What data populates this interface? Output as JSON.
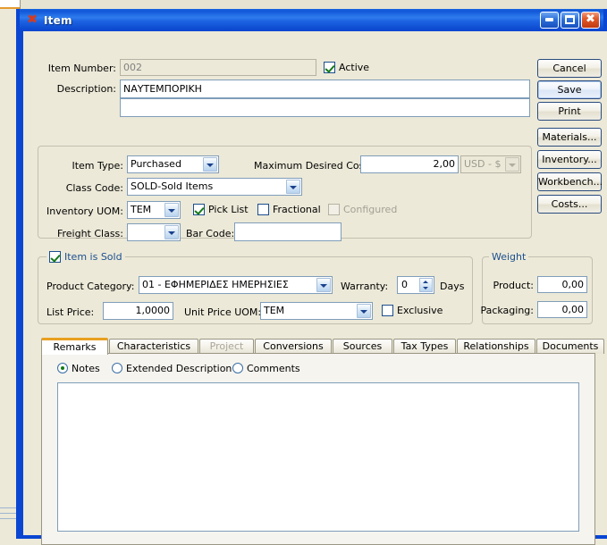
{
  "window": {
    "title": "Item",
    "icon": "app-x-icon",
    "buttons": {
      "minimize": "minimize",
      "maximize": "maximize",
      "close": "close"
    }
  },
  "form": {
    "item_number": {
      "label": "Item Number:",
      "value": "002",
      "disabled": true
    },
    "active": {
      "label": "Active",
      "checked": true
    },
    "description": {
      "label": "Description:",
      "line1": "ΝΑΥΤΕΜΠΟΡΙΚΗ",
      "line2": ""
    },
    "item_type": {
      "label": "Item Type:",
      "value": "Purchased"
    },
    "maximum_desired_cost": {
      "label": "Maximum Desired Cost:",
      "value": "2,00"
    },
    "currency": {
      "value": "USD - $",
      "disabled": true
    },
    "class_code": {
      "label": "Class Code:",
      "value": "SOLD-Sold Items"
    },
    "inventory_uom": {
      "label": "Inventory UOM:",
      "value": "TEM"
    },
    "pick_list": {
      "label": "Pick List",
      "checked": true
    },
    "fractional": {
      "label": "Fractional",
      "checked": false
    },
    "configured": {
      "label": "Configured",
      "checked": false,
      "disabled": true
    },
    "freight_class": {
      "label": "Freight Class:",
      "value": ""
    },
    "bar_code": {
      "label": "Bar Code:",
      "value": ""
    }
  },
  "item_is_sold": {
    "title": "Item is Sold",
    "checked": true,
    "product_category": {
      "label": "Product Category:",
      "value": "01 - ΕΦΗΜΕΡΙΔΕΣ ΗΜΕΡΗΣΙΕΣ"
    },
    "warranty": {
      "label": "Warranty:",
      "value": "0",
      "units": "Days"
    },
    "list_price": {
      "label": "List Price:",
      "value": "1,0000"
    },
    "unit_price_uom": {
      "label": "Unit Price UOM:",
      "value": "TEM"
    },
    "exclusive": {
      "label": "Exclusive",
      "checked": false
    }
  },
  "weight": {
    "title": "Weight",
    "product": {
      "label": "Product:",
      "value": "0,00"
    },
    "packaging": {
      "label": "Packaging:",
      "value": "0,00"
    }
  },
  "actions": {
    "cancel": "Cancel",
    "save": "Save",
    "print": "Print",
    "materials": "Materials...",
    "inventory": "Inventory...",
    "workbench": "Workbench...",
    "costs": "Costs..."
  },
  "tabs": [
    {
      "label": "Remarks",
      "active": true,
      "disabled": false
    },
    {
      "label": "Characteristics",
      "active": false,
      "disabled": false
    },
    {
      "label": "Project",
      "active": false,
      "disabled": true
    },
    {
      "label": "Conversions",
      "active": false,
      "disabled": false
    },
    {
      "label": "Sources",
      "active": false,
      "disabled": false
    },
    {
      "label": "Tax Types",
      "active": false,
      "disabled": false
    },
    {
      "label": "Relationships",
      "active": false,
      "disabled": false
    },
    {
      "label": "Documents",
      "active": false,
      "disabled": false
    }
  ],
  "remarks": {
    "options": [
      {
        "label": "Notes",
        "selected": true
      },
      {
        "label": "Extended Description",
        "selected": false
      },
      {
        "label": "Comments",
        "selected": false
      }
    ],
    "text": ""
  },
  "colors": {
    "title_blue": "#0a46d2",
    "face": "#ece9d8",
    "group_title": "#1c4f8f",
    "active_tab_accent": "#e8a020",
    "close_red": "#c03a12"
  }
}
